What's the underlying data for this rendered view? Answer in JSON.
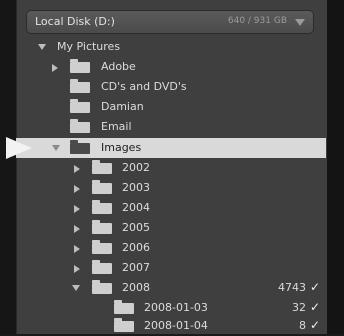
{
  "disk": {
    "name": "Local Disk (D:)",
    "size": "640 / 931 GB"
  },
  "root": {
    "label": "My Pictures"
  },
  "folders": [
    {
      "label": "Adobe"
    },
    {
      "label": "CD's and DVD's"
    },
    {
      "label": "Damian"
    },
    {
      "label": "Email"
    },
    {
      "label": "Images"
    }
  ],
  "years": [
    {
      "label": "2002"
    },
    {
      "label": "2003"
    },
    {
      "label": "2004"
    },
    {
      "label": "2005"
    },
    {
      "label": "2006"
    },
    {
      "label": "2007"
    },
    {
      "label": "2008",
      "count": "4743"
    }
  ],
  "subfolders": [
    {
      "label": "2008-01-03",
      "count": "32"
    },
    {
      "label": "2008-01-04",
      "count": "8"
    }
  ],
  "checkmark": "✓"
}
